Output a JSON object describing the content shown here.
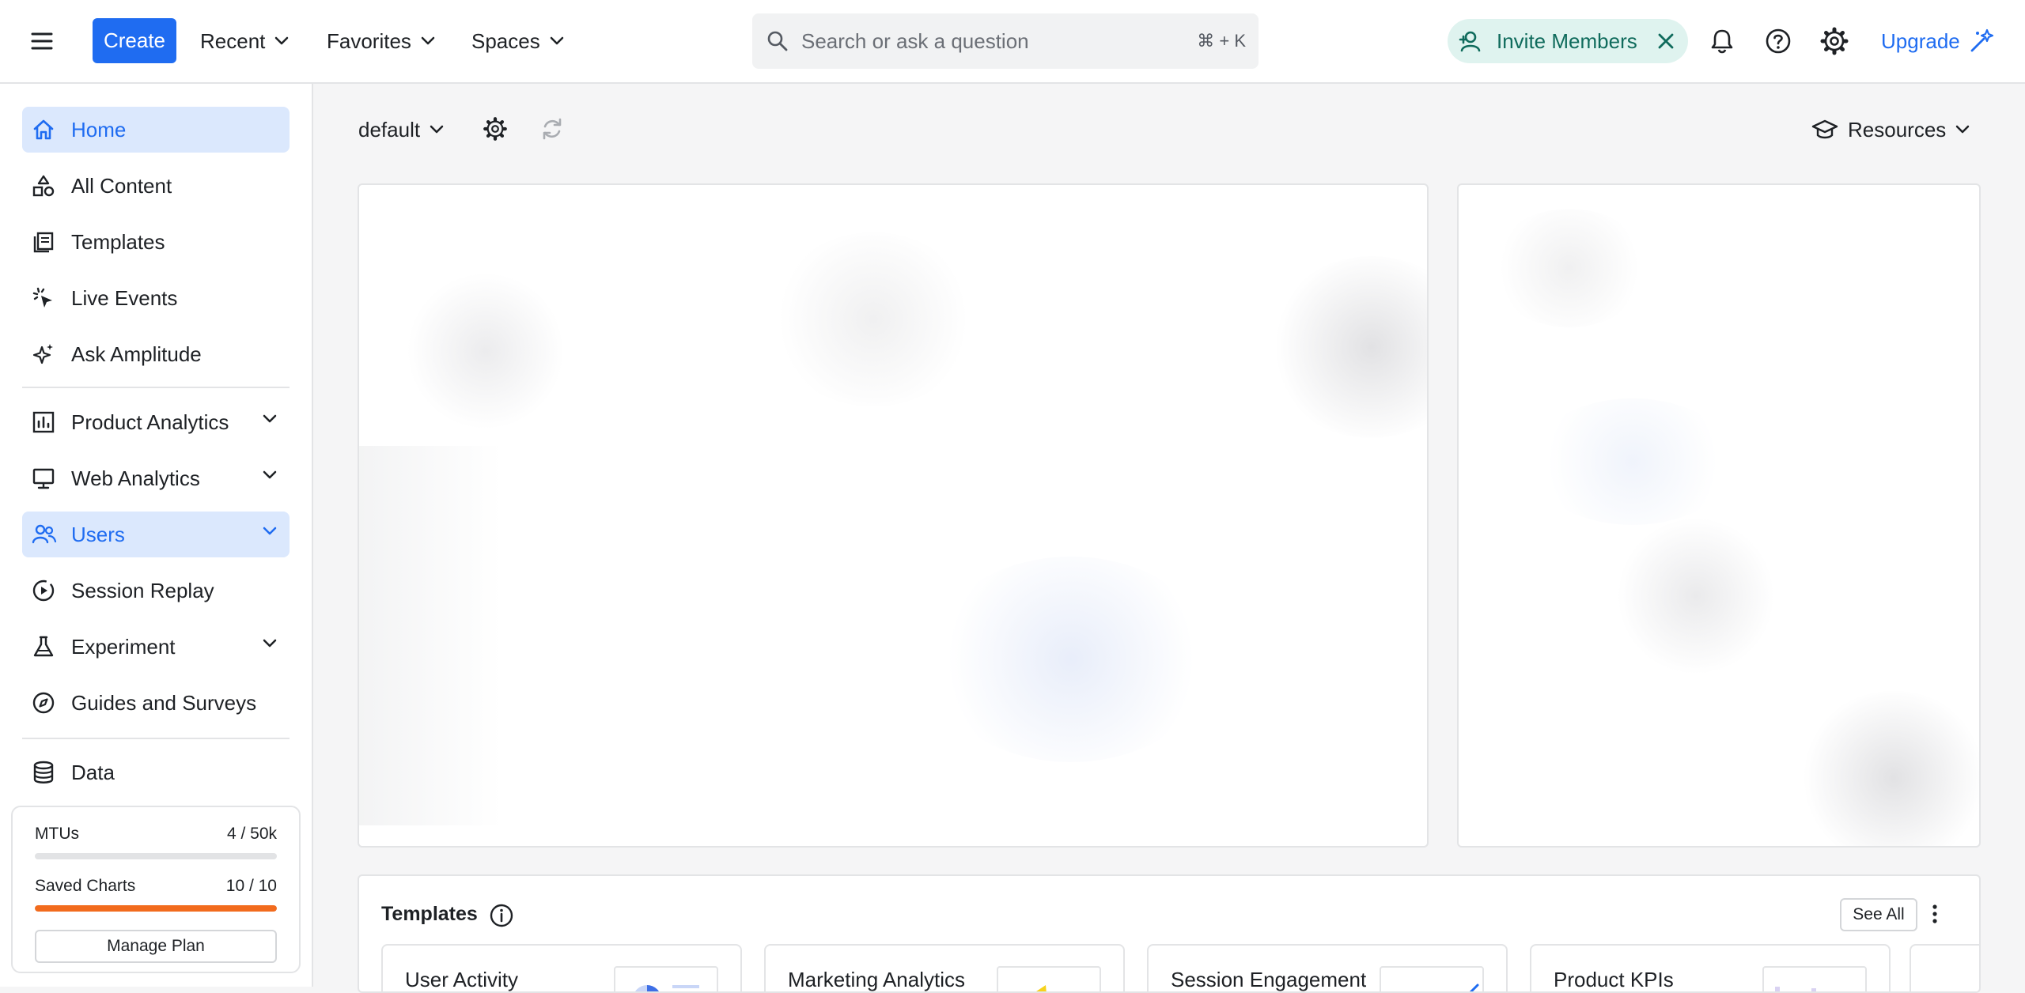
{
  "topbar": {
    "create_label": "Create",
    "nav": [
      {
        "label": "Recent"
      },
      {
        "label": "Favorites"
      },
      {
        "label": "Spaces"
      }
    ],
    "search": {
      "placeholder": "Search or ask a question",
      "shortcut": "⌘ + K"
    },
    "invite_label": "Invite Members",
    "upgrade_label": "Upgrade",
    "icons": [
      "hamburger-menu-icon",
      "search-icon",
      "user-plus-icon",
      "close-icon",
      "bell-icon",
      "help-icon",
      "gear-icon",
      "wand-icon"
    ]
  },
  "sidebar": {
    "items": [
      {
        "label": "Home",
        "icon": "home-icon",
        "active": true
      },
      {
        "label": "All Content",
        "icon": "shapes-icon"
      },
      {
        "label": "Templates",
        "icon": "templates-icon"
      },
      {
        "label": "Live Events",
        "icon": "live-events-icon"
      },
      {
        "label": "Ask Amplitude",
        "icon": "sparkle-icon"
      },
      {
        "label": "Product Analytics",
        "icon": "bar-chart-icon",
        "expandable": true
      },
      {
        "label": "Web Analytics",
        "icon": "monitor-icon",
        "expandable": true
      },
      {
        "label": "Users",
        "icon": "users-icon",
        "expandable": true,
        "active": true
      },
      {
        "label": "Session Replay",
        "icon": "play-circle-icon"
      },
      {
        "label": "Experiment",
        "icon": "flask-icon",
        "expandable": true
      },
      {
        "label": "Guides and Surveys",
        "icon": "compass-icon"
      },
      {
        "label": "Data",
        "icon": "database-icon"
      }
    ],
    "usage": {
      "mtus": {
        "label": "MTUs",
        "value": "4 / 50k",
        "fraction": 0.0001,
        "color": "#e2e3e5"
      },
      "saved_charts": {
        "label": "Saved Charts",
        "value": "10 / 10",
        "fraction": 1.0,
        "color": "#f26b1d"
      },
      "manage_label": "Manage Plan"
    }
  },
  "main": {
    "space_name": "default",
    "resources_label": "Resources",
    "templates": {
      "title": "Templates",
      "see_all_label": "See All",
      "cards": [
        {
          "name": "User Activity"
        },
        {
          "name": "Marketing Analytics"
        },
        {
          "name": "Session Engagement"
        },
        {
          "name": "Product KPIs"
        }
      ]
    }
  },
  "colors": {
    "accent": "#1f6cf1",
    "active_bg": "#dbe8fd",
    "invite_bg": "#dff3ef",
    "invite_text": "#0f6b5c",
    "warning_bar": "#f26b1d"
  }
}
